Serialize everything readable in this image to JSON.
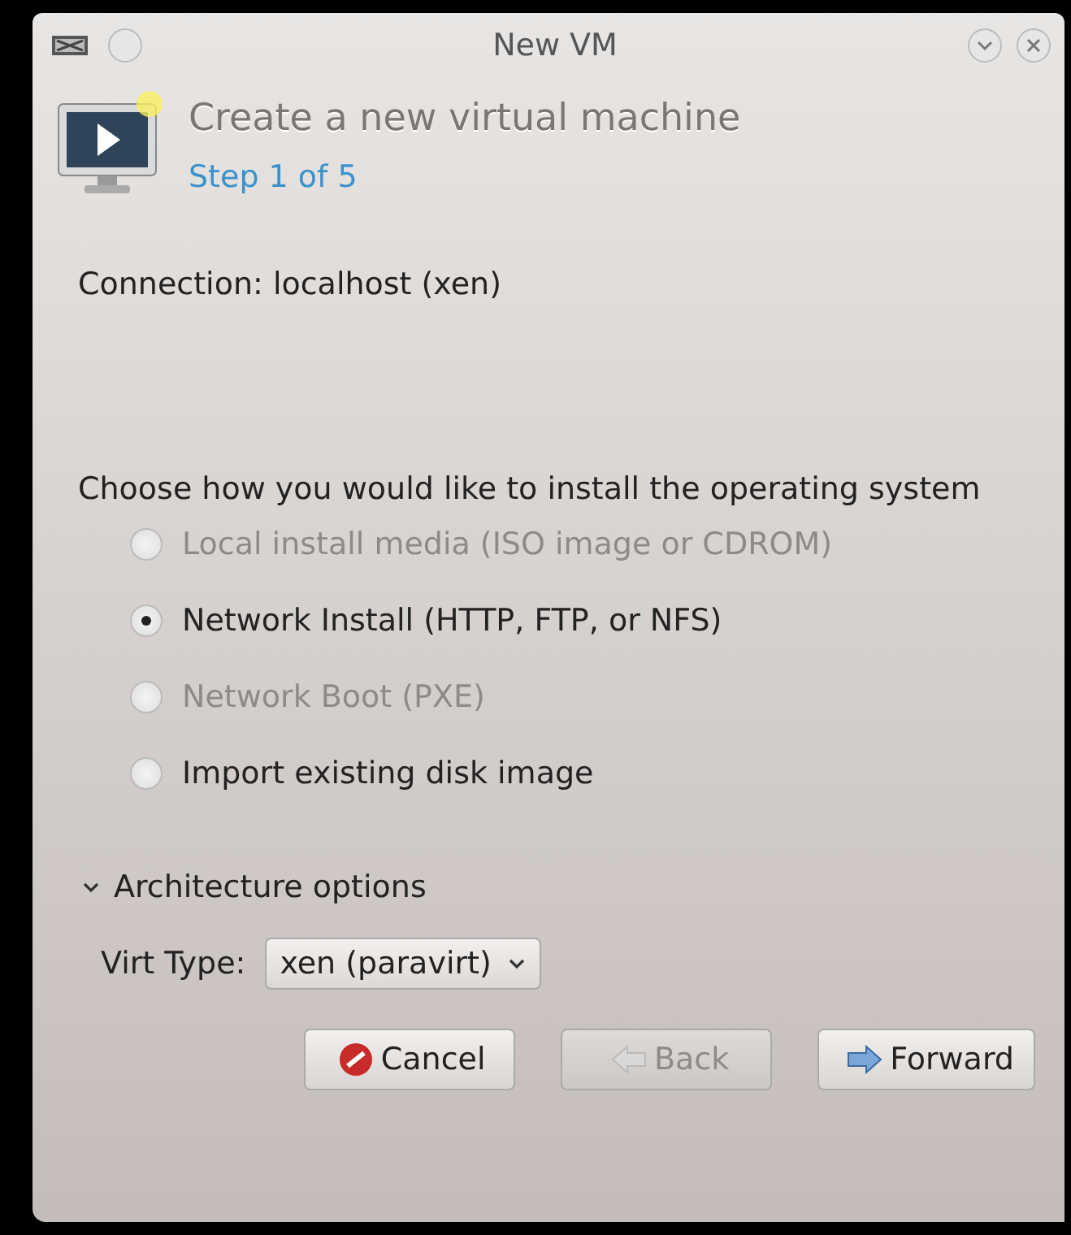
{
  "window": {
    "title": "New VM"
  },
  "header": {
    "title": "Create a new virtual machine",
    "step": "Step 1 of 5"
  },
  "connection": "Connection: localhost (xen)",
  "install_prompt": "Choose how you would like to install the operating system",
  "install_options": [
    {
      "label": "Local install media (ISO image or CDROM)",
      "selected": false,
      "disabled": true
    },
    {
      "label": "Network Install (HTTP, FTP, or NFS)",
      "selected": true,
      "disabled": false
    },
    {
      "label": "Network Boot (PXE)",
      "selected": false,
      "disabled": true
    },
    {
      "label": "Import existing disk image",
      "selected": false,
      "disabled": false
    }
  ],
  "architecture": {
    "label": "Architecture options",
    "expanded": true,
    "virt_type_label": "Virt Type:",
    "virt_type": "xen (paravirt)"
  },
  "buttons": [
    {
      "kind": "cancel",
      "label": "Cancel",
      "disabled": false
    },
    {
      "kind": "back",
      "label": "Back",
      "disabled": true
    },
    {
      "kind": "forward",
      "label": "Forward",
      "disabled": false
    }
  ]
}
